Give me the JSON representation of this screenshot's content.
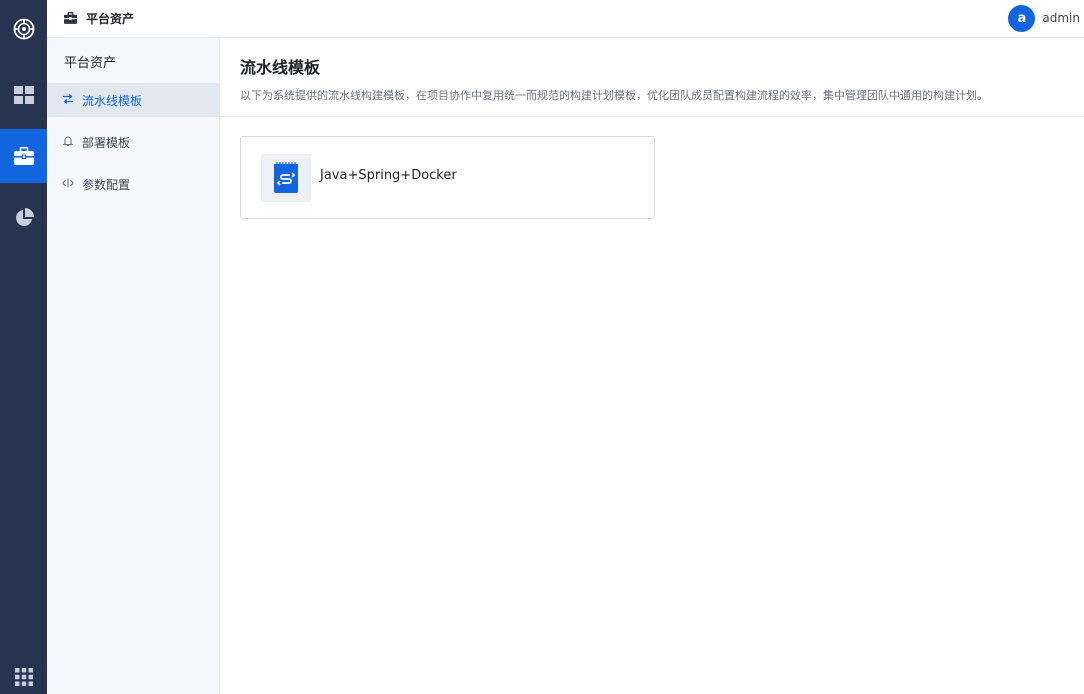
{
  "rail": {
    "items": [
      {
        "icon": "logo-icon"
      },
      {
        "icon": "dashboard-grid-icon"
      },
      {
        "icon": "briefcase-icon",
        "active": true
      },
      {
        "icon": "pie-chart-icon"
      },
      {
        "icon": "apps-grid-icon"
      }
    ]
  },
  "header": {
    "icon": "briefcase-icon",
    "title": "平台资产",
    "user": {
      "avatar_letter": "a",
      "name": "admin"
    }
  },
  "sidebar": {
    "title": "平台资产",
    "items": [
      {
        "label": "流水线模板",
        "icon": "pipeline-icon",
        "active": true
      },
      {
        "label": "部署模板",
        "icon": "bell-icon"
      },
      {
        "label": "参数配置",
        "icon": "code-icon"
      }
    ]
  },
  "main": {
    "title": "流水线模板",
    "description": "以下为系统提供的流水线构建模板，在项目协作中复用统一而规范的构建计划模板，优化团队成员配置构建流程的效率，集中管理团队中通用的构建计划。",
    "cards": [
      {
        "label": "Java+Spring+Docker",
        "icon": "template-icon"
      }
    ]
  },
  "colors": {
    "rail_bg": "#27334f",
    "accent": "#1166e0",
    "sidebar_bg": "#f5f7fa"
  }
}
